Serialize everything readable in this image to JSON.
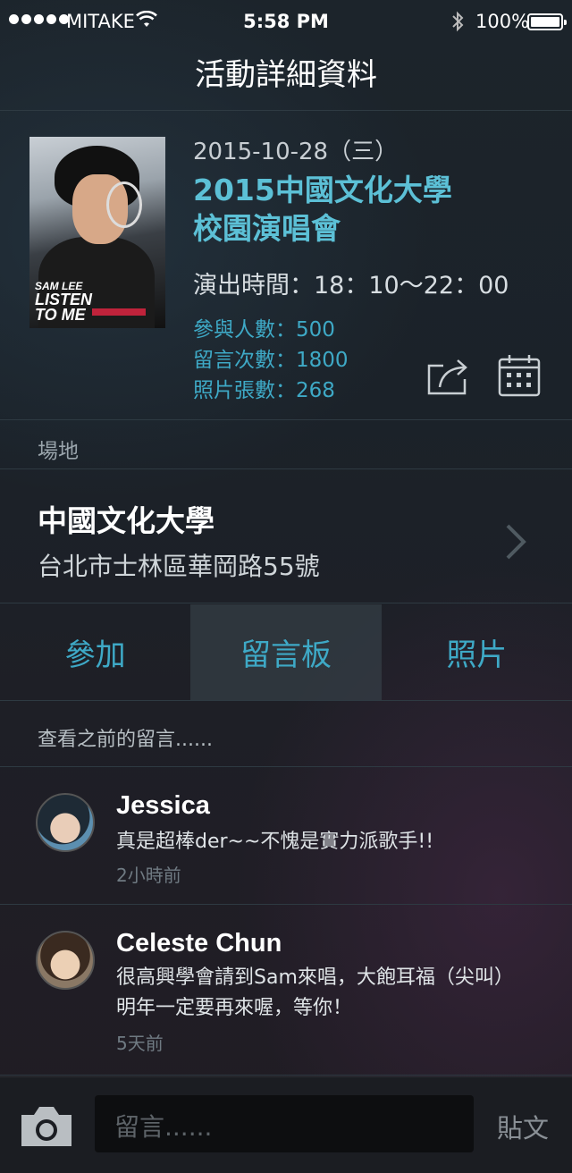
{
  "status_bar": {
    "carrier": "MITAKE",
    "time": "5:58 PM",
    "battery": "100%"
  },
  "nav": {
    "title": "活動詳細資料"
  },
  "event": {
    "date": "2015-10-28（三）",
    "title_line1": "2015中國文化大學",
    "title_line2": "校園演唱會",
    "show_time": "演出時間：18：10～22：00",
    "participants": "參與人數：500",
    "comments_count": "留言次數：1800",
    "photos_count": "照片張數：268",
    "poster_text_1": "SAM LEE",
    "poster_text_2": "LISTEN",
    "poster_text_3": "TO ME"
  },
  "venue": {
    "section_label": "場地",
    "name": "中國文化大學",
    "address": "台北市士林區華岡路55號"
  },
  "tabs": [
    {
      "label": "參加"
    },
    {
      "label": "留言板"
    },
    {
      "label": "照片"
    }
  ],
  "comments": {
    "view_previous": "查看之前的留言......",
    "items": [
      {
        "name": "Jessica",
        "text_line1": "真是超棒der~~不愧是實力派歌手!!",
        "text_line2": "",
        "ago": "2小時前"
      },
      {
        "name": "Celeste Chun",
        "text_line1": "很高興學會請到Sam來唱，大飽耳福（尖叫）",
        "text_line2": "明年一定要再來喔，等你！",
        "ago": "5天前"
      }
    ]
  },
  "input_bar": {
    "placeholder": "留言......",
    "post_label": "貼文"
  },
  "colors": {
    "accent": "#3ea9c6",
    "title_accent": "#5cc0d6"
  }
}
